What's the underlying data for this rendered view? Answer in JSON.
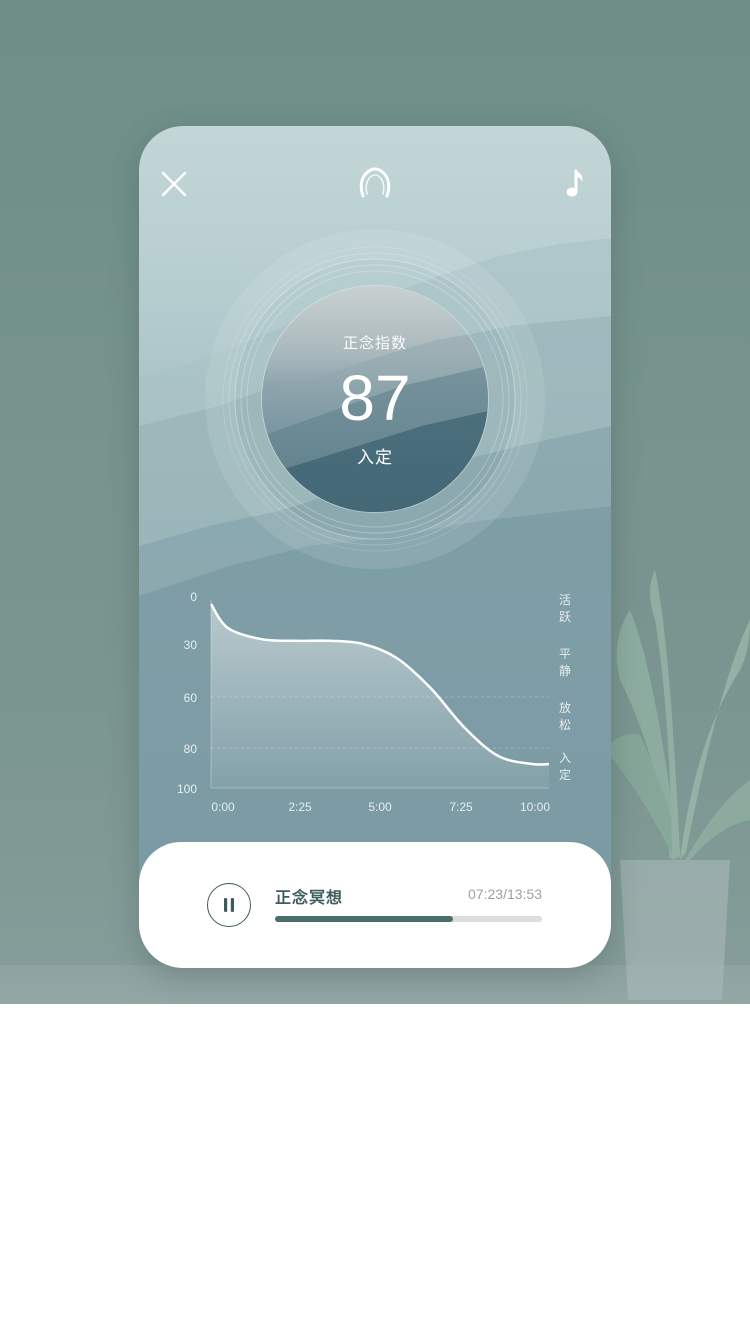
{
  "header": {
    "close_icon": "close-icon",
    "center_icon": "headphones-icon",
    "music_icon": "music-note-icon"
  },
  "score": {
    "title": "正念指数",
    "value": "87",
    "state": "入定"
  },
  "chart_data": {
    "type": "area",
    "x_ticks": [
      "0:00",
      "2:25",
      "5:00",
      "7:25",
      "10:00"
    ],
    "y_ticks": [
      "0",
      "30",
      "60",
      "80",
      "100"
    ],
    "y_inverted": true,
    "ylim": [
      0,
      100
    ],
    "zones": [
      "活跃",
      "平静",
      "放松",
      "入定"
    ],
    "x_minutes": [
      0,
      0.5,
      1.5,
      2.5,
      3.5,
      4.5,
      5.5,
      6.5,
      7.5,
      8.5,
      9.5,
      10
    ],
    "values": [
      5,
      20,
      27,
      28,
      28,
      30,
      38,
      55,
      72,
      84,
      88,
      88
    ]
  },
  "player": {
    "title": "正念冥想",
    "time": "07:23/13:53",
    "progress": 0.667
  },
  "colors": {
    "accent": "#4a6f6a",
    "card_bottom": "#4b7180",
    "background": "#76938d"
  }
}
